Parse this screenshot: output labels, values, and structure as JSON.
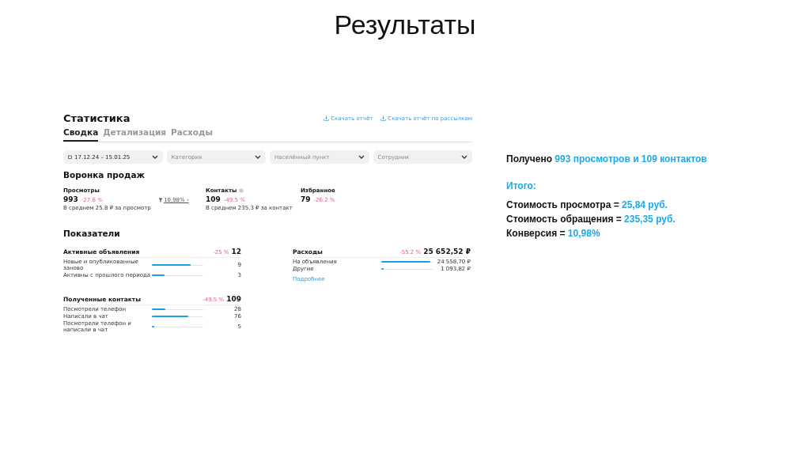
{
  "slide_title": "Результаты",
  "panel": {
    "title": "Статистика",
    "links": [
      "Скачать отчёт",
      "Скачать отчёт по рассылкам"
    ],
    "tabs": [
      {
        "label": "Сводка",
        "selected": true
      },
      {
        "label": "Детализация",
        "selected": false
      },
      {
        "label": "Расходы",
        "selected": false
      }
    ],
    "filters": [
      {
        "kind": "date",
        "value": "17.12.24 – 15.01.25"
      },
      {
        "kind": "select",
        "placeholder": "Категория"
      },
      {
        "kind": "select",
        "placeholder": "Населённый пункт"
      },
      {
        "kind": "select",
        "placeholder": "Сотрудник"
      }
    ],
    "funnel": {
      "title": "Воронка продаж",
      "conversion": "10,98% ›",
      "metrics": [
        {
          "label": "Просмотры",
          "value": "993",
          "change": "-27.6 %",
          "note": "В среднем 25.8 ₽ за просмотр",
          "info": false
        },
        {
          "label": "Контакты",
          "value": "109",
          "change": "-49.5 %",
          "note": "В среднем 235.3 ₽ за контакт",
          "info": true
        },
        {
          "label": "Избранное",
          "value": "79",
          "change": "-26.2 %",
          "info": false
        }
      ]
    },
    "indicators": {
      "title": "Показатели",
      "blocks": [
        {
          "title": "Активные объявления",
          "change": "-25 %",
          "total": "12",
          "rows": [
            {
              "label": "Новые и опубликованные заново",
              "level": 0.75,
              "value": "9"
            },
            {
              "label": "Активны с прошлого периода",
              "level": 0.25,
              "value": "3"
            }
          ]
        },
        {
          "title": "Расходы",
          "change": "-55.2 %",
          "total": "25 652,52 ₽",
          "rows": [
            {
              "label": "На объявления",
              "level": 0.96,
              "value": "24 558,70 ₽"
            },
            {
              "label": "Другие",
              "level": 0.04,
              "value": "1 093,82 ₽"
            }
          ],
          "link": "Подробнее"
        },
        {
          "title": "Полученные контакты",
          "change": "-49.5 %",
          "total": "109",
          "rows": [
            {
              "label": "Посмотрели телефон",
              "level": 0.26,
              "value": "28"
            },
            {
              "label": "Написали в чат",
              "level": 0.7,
              "value": "76"
            },
            {
              "label": "Посмотрели телефон и написали в чат",
              "level": 0.05,
              "value": "5"
            }
          ]
        }
      ]
    }
  },
  "notes": [
    {
      "kind": "line",
      "parts": [
        {
          "text": "Получено ",
          "highlight": false
        },
        {
          "text": "993 просмотров и 109 контактов",
          "highlight": true
        }
      ]
    },
    {
      "kind": "heading",
      "parts": [
        {
          "text": "Итого:",
          "highlight": true
        }
      ]
    },
    {
      "kind": "line",
      "parts": [
        {
          "text": "Стоимость просмотра = ",
          "highlight": false
        },
        {
          "text": "25,84 руб.",
          "highlight": true
        }
      ]
    },
    {
      "kind": "line",
      "parts": [
        {
          "text": "Стоимость обращения = ",
          "highlight": false
        },
        {
          "text": "235,35 руб.",
          "highlight": true
        }
      ]
    },
    {
      "kind": "line",
      "parts": [
        {
          "text": "Конверсия = ",
          "highlight": false
        },
        {
          "text": "10,98%",
          "highlight": true
        }
      ]
    }
  ]
}
